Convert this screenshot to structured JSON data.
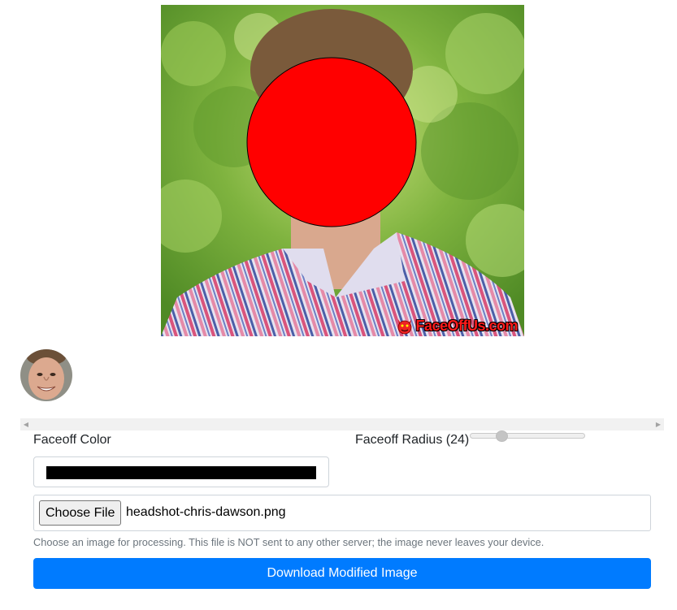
{
  "preview": {
    "watermark_text": "FaceOffUs.com",
    "watermark_icon": "devil-face-icon",
    "faceoff_circle_color": "#ff0000",
    "photo_alt": "headshot photo with face covered by red circle"
  },
  "thumbnails": [
    {
      "icon": "detected-face-thumbnail"
    }
  ],
  "controls": {
    "color_label": "Faceoff Color",
    "color_value": "#000000",
    "radius_label_prefix": "Faceoff Radius (",
    "radius_value": "24",
    "radius_label_suffix": ")",
    "radius_slider_fraction": 0.25
  },
  "file": {
    "button_label": "Choose File",
    "file_name": "headshot-chris-dawson.png",
    "help_text": "Choose an image for processing. This file is NOT sent to any other server; the image never leaves your device."
  },
  "download": {
    "label": "Download Modified Image",
    "color": "#007bff"
  },
  "scrollbar": {
    "left_arrow": "◀",
    "right_arrow": "▶"
  }
}
